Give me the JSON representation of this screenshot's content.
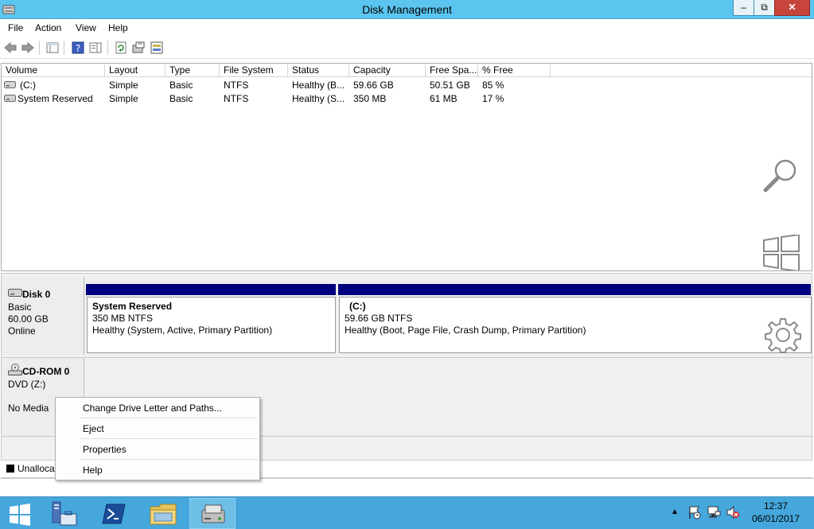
{
  "window": {
    "title": "Disk Management",
    "min": "–",
    "max": "⧉",
    "close": "✕"
  },
  "menu": [
    "File",
    "Action",
    "View",
    "Help"
  ],
  "volume_list": {
    "columns": [
      "Volume",
      "Layout",
      "Type",
      "File System",
      "Status",
      "Capacity",
      "Free Spa...",
      "% Free"
    ],
    "rows": [
      [
        "(C:)",
        "Simple",
        "Basic",
        "NTFS",
        "Healthy (B...",
        "59.66 GB",
        "50.51 GB",
        "85 %"
      ],
      [
        "System Reserved",
        "Simple",
        "Basic",
        "NTFS",
        "Healthy (S...",
        "350 MB",
        "61 MB",
        "17 %"
      ]
    ]
  },
  "disks": {
    "disk0": {
      "name": "Disk 0",
      "type": "Basic",
      "size": "60.00 GB",
      "status": "Online",
      "partitions": [
        {
          "name": "System Reserved",
          "size": "350 MB NTFS",
          "status": "Healthy (System, Active, Primary Partition)"
        },
        {
          "name": "(C:)",
          "size": "59.66 GB NTFS",
          "status": "Healthy (Boot, Page File, Crash Dump, Primary Partition)"
        }
      ]
    },
    "cdrom0": {
      "name": "CD-ROM 0",
      "type": "DVD (Z:)",
      "status": "No Media"
    }
  },
  "legend": {
    "unallocated": "Unalloca"
  },
  "context_menu": [
    "Change Drive Letter and Paths...",
    "Eject",
    "Properties",
    "Help"
  ],
  "clock": {
    "time": "12:37",
    "date": "06/01/2017"
  },
  "colors": {
    "titlebar": "#5bc5ef",
    "partition_bar": "#00007f",
    "taskbar": "#45a7dc"
  }
}
